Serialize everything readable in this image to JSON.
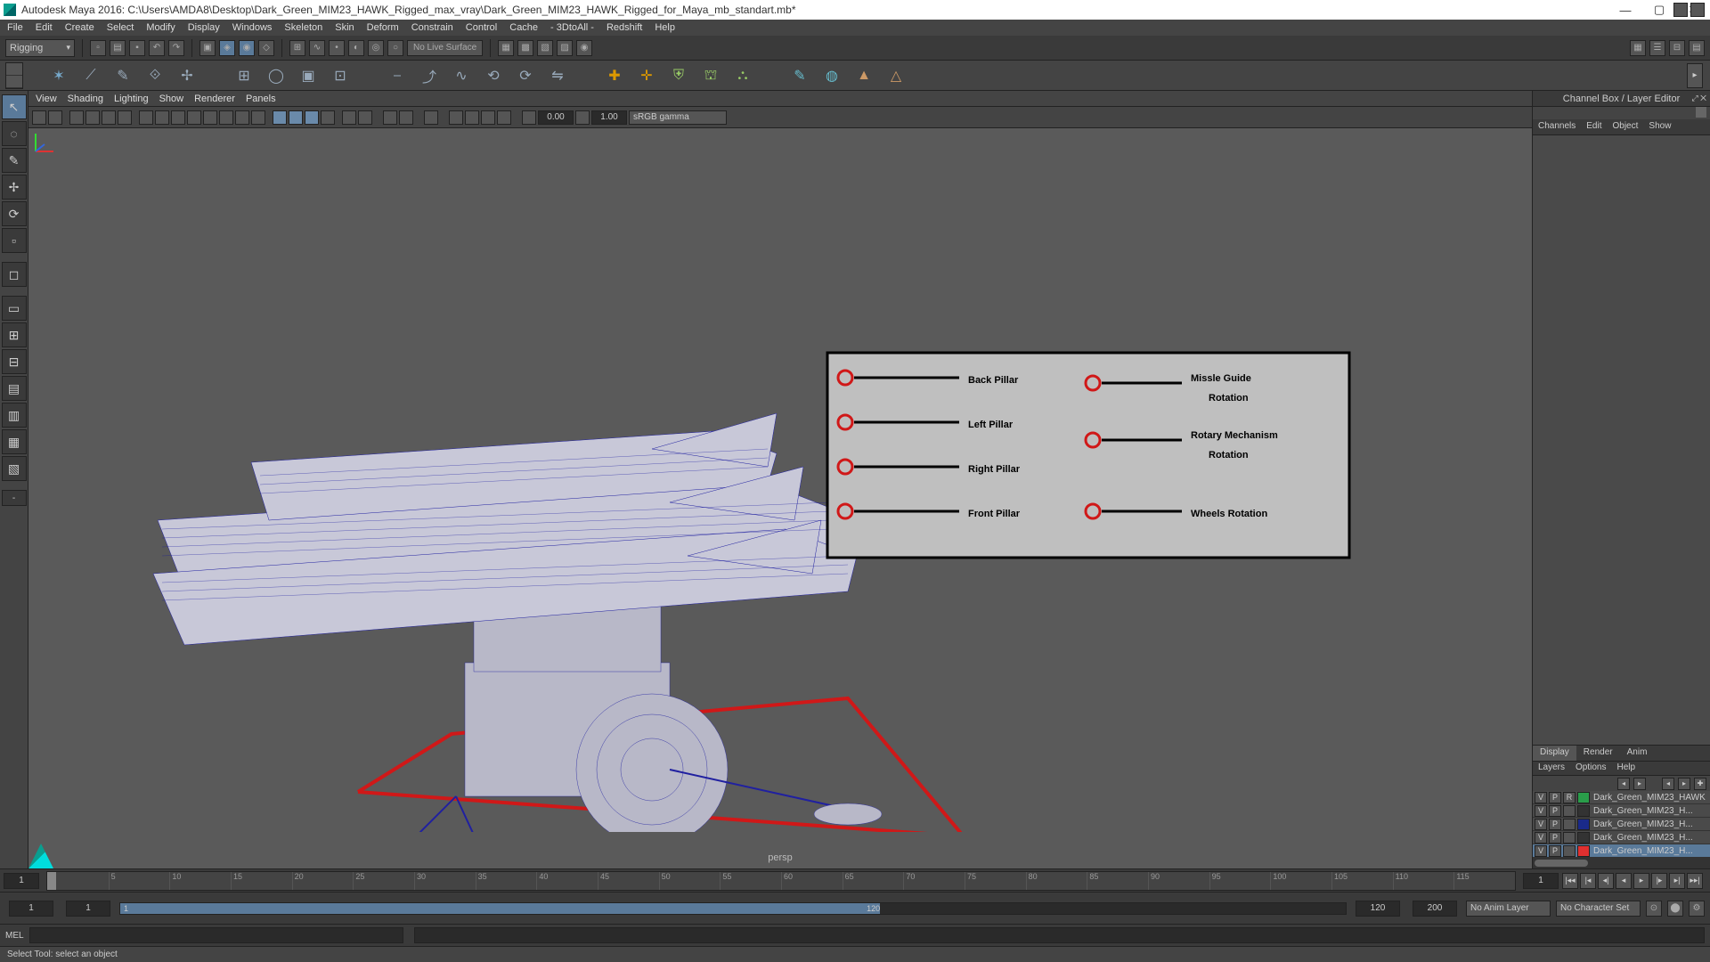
{
  "title": "Autodesk Maya 2016: C:\\Users\\AMDA8\\Desktop\\Dark_Green_MIM23_HAWK_Rigged_max_vray\\Dark_Green_MIM23_HAWK_Rigged_for_Maya_mb_standart.mb*",
  "menubar": [
    "File",
    "Edit",
    "Create",
    "Select",
    "Modify",
    "Display",
    "Windows",
    "Skeleton",
    "Skin",
    "Deform",
    "Constrain",
    "Control",
    "Cache",
    "- 3DtoAll -",
    "Redshift",
    "Help"
  ],
  "workspace": "Rigging",
  "live_surface": "No Live Surface",
  "panel_menu": [
    "View",
    "Shading",
    "Lighting",
    "Show",
    "Renderer",
    "Panels"
  ],
  "viewport_num1": "0.00",
  "viewport_num2": "1.00",
  "gamma": "sRGB gamma",
  "camera": "persp",
  "channelbox": {
    "title": "Channel Box / Layer Editor",
    "tabs": [
      "Channels",
      "Edit",
      "Object",
      "Show"
    ]
  },
  "display_tabs": [
    "Display",
    "Render",
    "Anim"
  ],
  "layer_menu": [
    "Layers",
    "Options",
    "Help"
  ],
  "layers": [
    {
      "v": "V",
      "p": "P",
      "r": "R",
      "color": "#2a9d4a",
      "name": "Dark_Green_MIM23_HAWK",
      "sel": false
    },
    {
      "v": "V",
      "p": "P",
      "r": "",
      "color": "#333",
      "name": "Dark_Green_MIM23_H...",
      "sel": false
    },
    {
      "v": "V",
      "p": "P",
      "r": "",
      "color": "#1a2a8a",
      "name": "Dark_Green_MIM23_H...",
      "sel": false
    },
    {
      "v": "V",
      "p": "P",
      "r": "",
      "color": "#333",
      "name": "Dark_Green_MIM23_H...",
      "sel": false
    },
    {
      "v": "V",
      "p": "P",
      "r": "",
      "color": "#e03030",
      "name": "Dark_Green_MIM23_H...",
      "sel": true
    }
  ],
  "timeline": {
    "start": "1",
    "end": "1",
    "ticks": [
      "5",
      "10",
      "15",
      "20",
      "25",
      "30",
      "35",
      "40",
      "45",
      "50",
      "55",
      "60",
      "65",
      "70",
      "75",
      "80",
      "85",
      "90",
      "95",
      "100",
      "105",
      "110",
      "115"
    ]
  },
  "range": {
    "f1": "1",
    "f2": "1",
    "cur": "1",
    "end": "120",
    "r1": "120",
    "r2": "200",
    "anim": "No Anim Layer",
    "char": "No Character Set"
  },
  "cmd": "MEL",
  "help": "Select Tool: select an object",
  "rig_panel": {
    "left": [
      "Back Pillar",
      "Left Pillar",
      "Right Pillar",
      "Front Pillar"
    ],
    "right": [
      "Missle Guide Rotation",
      "Rotary Mechanism Rotation",
      "Wheels Rotation"
    ]
  }
}
